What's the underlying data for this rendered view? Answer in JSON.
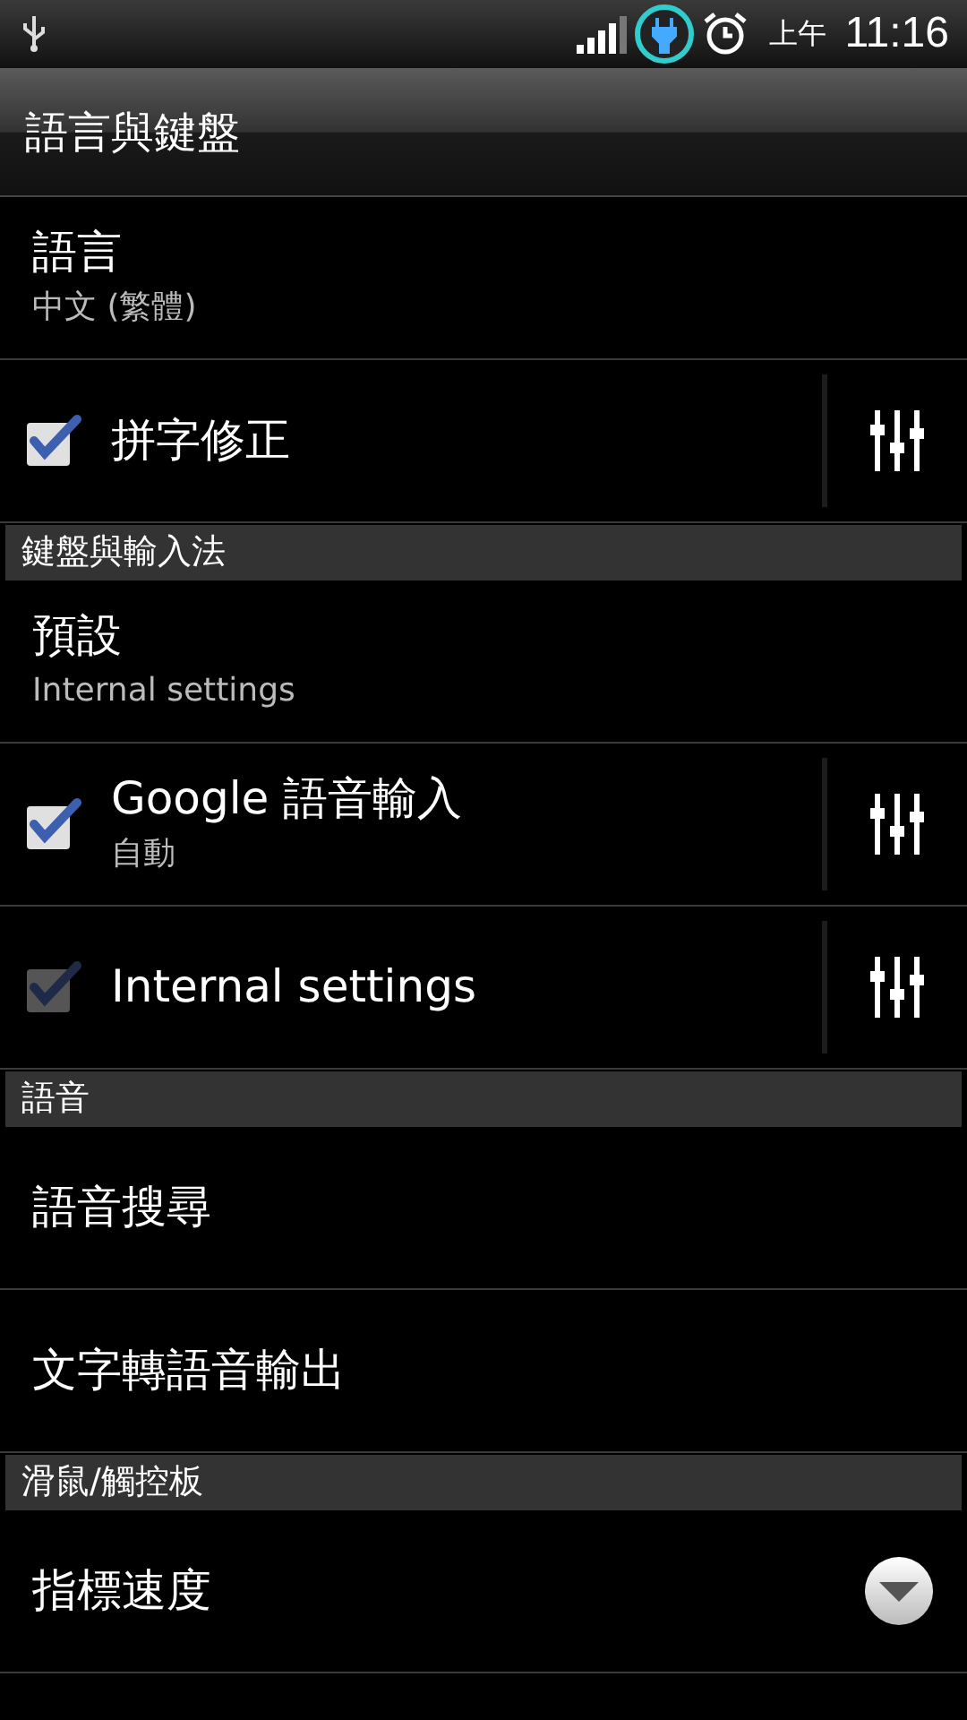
{
  "status_bar": {
    "ampm": "上午",
    "time": "11:16"
  },
  "title": "語言與鍵盤",
  "items": [
    {
      "kind": "item",
      "title": "語言",
      "summary": "中文 (繁體)"
    },
    {
      "kind": "check",
      "title": "拼字修正",
      "checked": true,
      "disabled": false
    },
    {
      "kind": "header",
      "title": "鍵盤與輸入法"
    },
    {
      "kind": "item",
      "title": "預設",
      "summary": "Internal settings"
    },
    {
      "kind": "check",
      "title": "Google 語音輸入",
      "summary": "自動",
      "checked": true,
      "disabled": false
    },
    {
      "kind": "check",
      "title": "Internal settings",
      "checked": true,
      "disabled": true
    },
    {
      "kind": "header",
      "title": "語音"
    },
    {
      "kind": "item",
      "title": "語音搜尋"
    },
    {
      "kind": "item",
      "title": "文字轉語音輸出"
    },
    {
      "kind": "header",
      "title": "滑鼠/觸控板"
    },
    {
      "kind": "dropdown",
      "title": "指標速度"
    }
  ]
}
